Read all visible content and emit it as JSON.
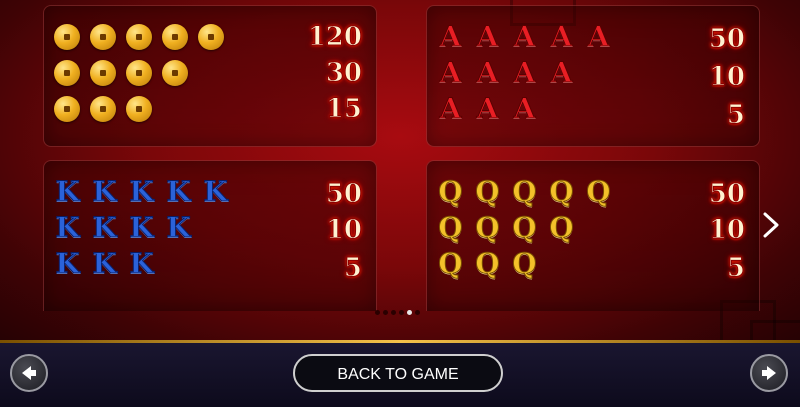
{
  "paytable": {
    "panels": [
      {
        "symbol": "coin",
        "rows": [
          {
            "count": 5,
            "payout": "120"
          },
          {
            "count": 4,
            "payout": "30"
          },
          {
            "count": 3,
            "payout": "15"
          }
        ]
      },
      {
        "symbol": "A",
        "rows": [
          {
            "count": 5,
            "payout": "50"
          },
          {
            "count": 4,
            "payout": "10"
          },
          {
            "count": 3,
            "payout": "5"
          }
        ]
      },
      {
        "symbol": "K",
        "rows": [
          {
            "count": 5,
            "payout": "50"
          },
          {
            "count": 4,
            "payout": "10"
          },
          {
            "count": 3,
            "payout": "5"
          }
        ]
      },
      {
        "symbol": "Q",
        "rows": [
          {
            "count": 5,
            "payout": "50"
          },
          {
            "count": 4,
            "payout": "10"
          },
          {
            "count": 3,
            "payout": "5"
          }
        ]
      }
    ]
  },
  "pagination": {
    "total": 6,
    "current": 5
  },
  "footer": {
    "back_label": "BACK TO GAME"
  },
  "icons": {
    "prev": "arrow-left-icon",
    "next": "arrow-right-icon",
    "page_next": "chevron-right-icon"
  },
  "colors": {
    "background": "#8a0a0d",
    "accent_gold": "#f5c24a",
    "letter_a": "#e81e24",
    "letter_k": "#2b62d9",
    "letter_q": "#f3c12a"
  }
}
